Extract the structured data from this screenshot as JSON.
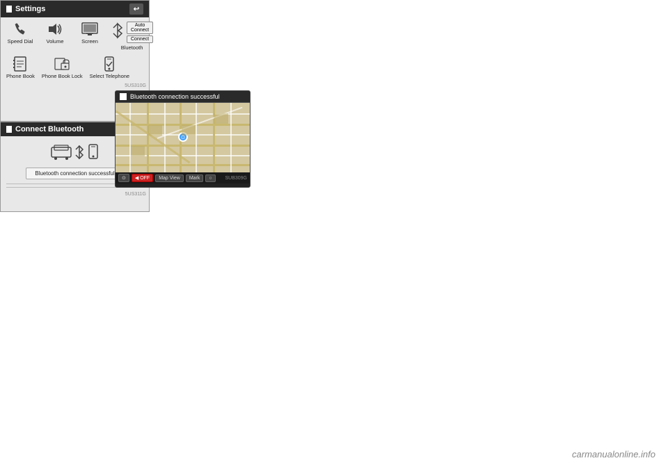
{
  "watermark": {
    "text": "carmanualonline.info"
  },
  "map_panel": {
    "header_text": "Bluetooth connection successful",
    "footer": {
      "btn1": "⊙",
      "btn2": "◀ OFF",
      "btn3": "Map View",
      "btn4": "Mark",
      "btn5": "○",
      "code": "SUB309G"
    }
  },
  "settings_panel": {
    "title": "Settings",
    "back_icon": "↩",
    "items_row1": [
      {
        "icon": "📞",
        "label": "Speed Dial"
      },
      {
        "icon": "🔊",
        "label": "Volume"
      },
      {
        "icon": "🖥",
        "label": "Screen"
      },
      {
        "icon": "bluetooth",
        "label": "Bluetooth"
      }
    ],
    "bt_buttons": [
      "Auto Connect",
      "Connect"
    ],
    "items_row2": [
      {
        "icon": "📖",
        "label": "Phone Book"
      },
      {
        "icon": "🔒",
        "label": "Phone Book Lock"
      },
      {
        "icon": "📱",
        "label": "Select Telephone"
      }
    ],
    "code": "5US310G"
  },
  "connect_panel": {
    "title": "Connect Bluetooth",
    "status": "Bluetooth connection successful",
    "code": "5US311G"
  }
}
